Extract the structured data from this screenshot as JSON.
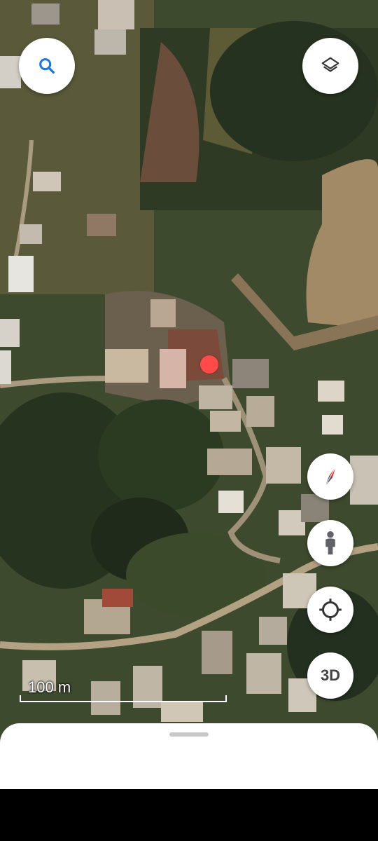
{
  "map": {
    "scale_label": "100 m",
    "location_pin_color": "#ff4a4a"
  },
  "controls": {
    "search_icon": "search-icon",
    "layers_icon": "layers-icon",
    "compass_icon": "compass-icon",
    "street_view_icon": "pegman-icon",
    "my_location_icon": "my-location-icon",
    "three_d_label": "3D"
  },
  "colors": {
    "accent": "#1a73e8",
    "compass_red": "#e53935"
  }
}
